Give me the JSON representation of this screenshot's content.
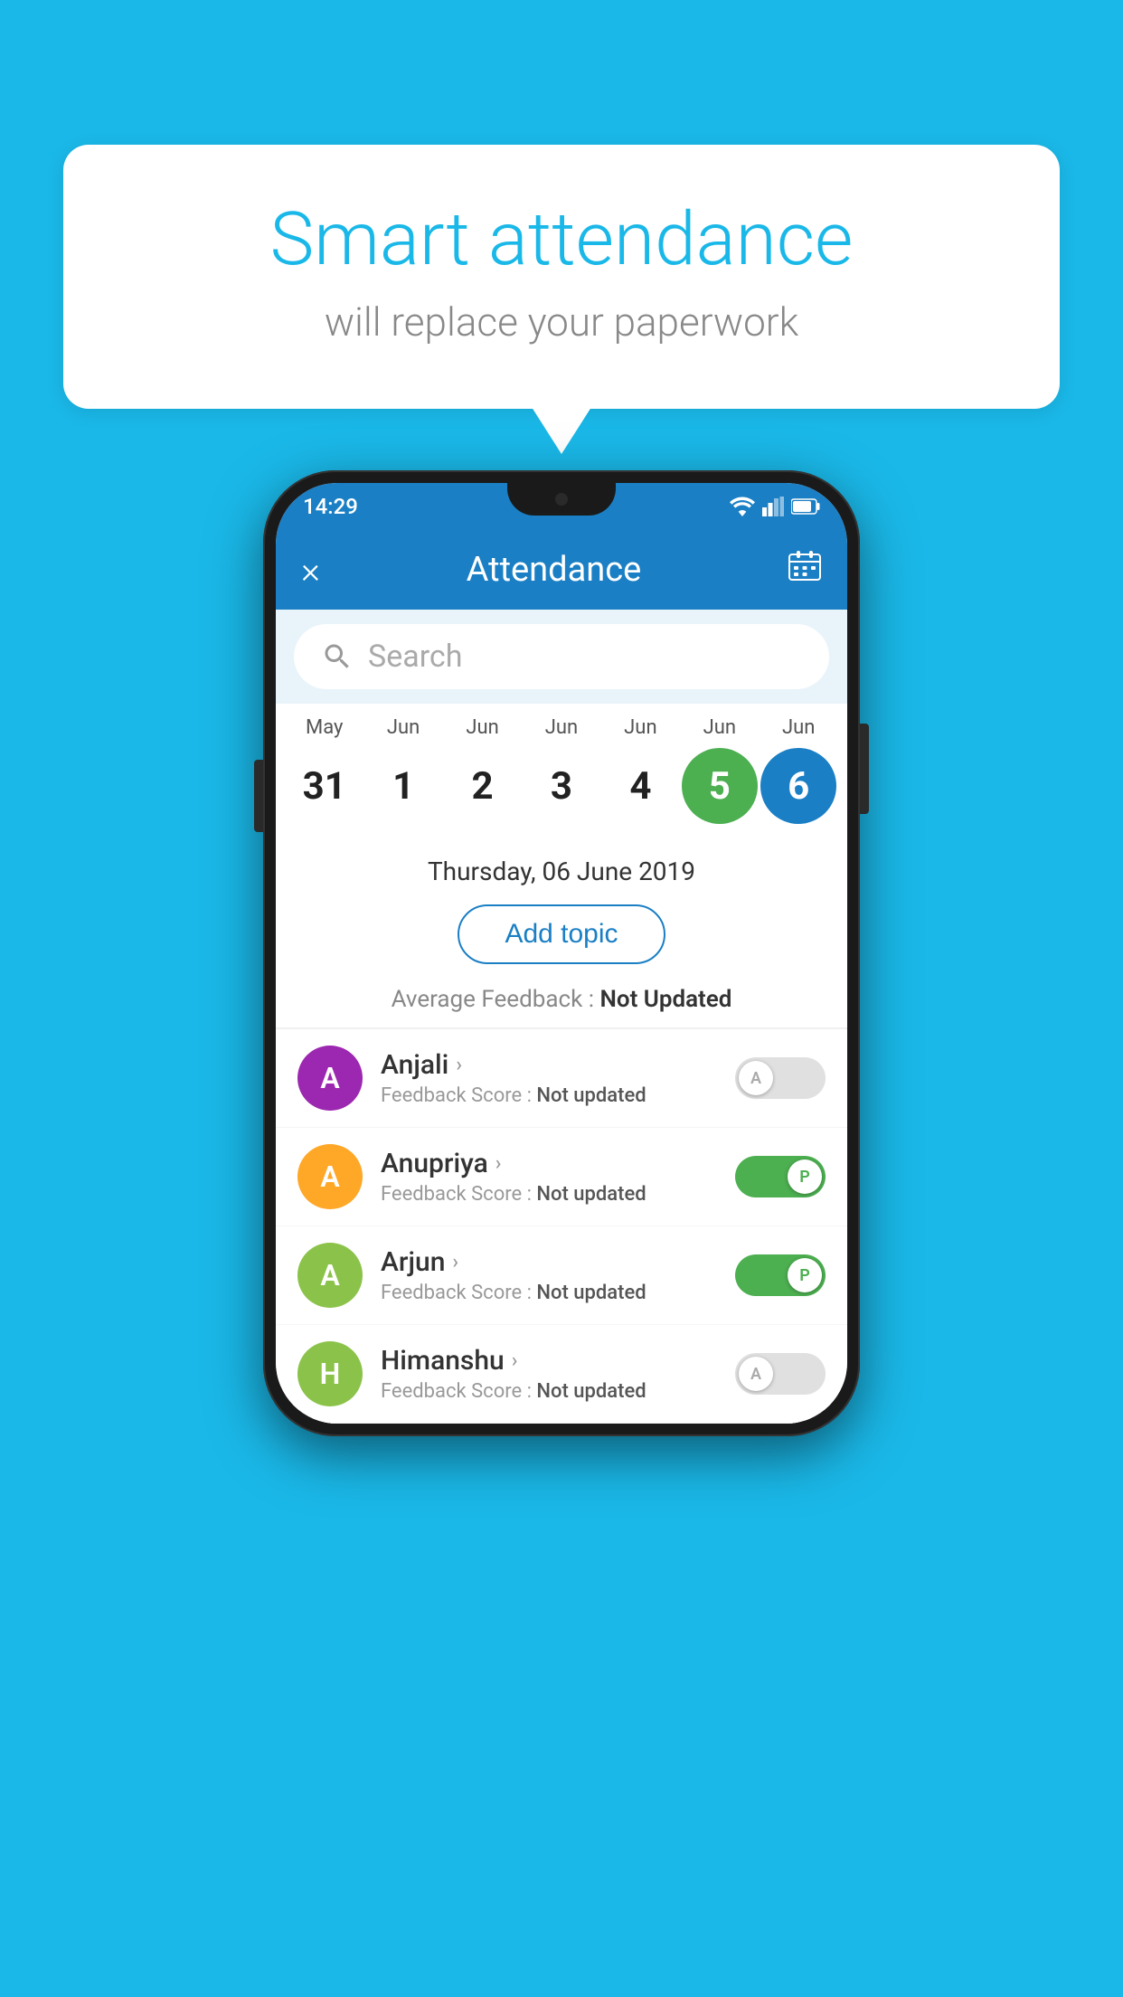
{
  "background": {
    "color": "#1ab8e8"
  },
  "speech_bubble": {
    "title": "Smart attendance",
    "subtitle": "will replace your paperwork"
  },
  "status_bar": {
    "time": "14:29"
  },
  "app_header": {
    "title": "Attendance",
    "close_label": "×",
    "calendar_label": "📅"
  },
  "search": {
    "placeholder": "Search"
  },
  "calendar": {
    "months": [
      "May",
      "Jun",
      "Jun",
      "Jun",
      "Jun",
      "Jun",
      "Jun"
    ],
    "dates": [
      "31",
      "1",
      "2",
      "3",
      "4",
      "5",
      "6"
    ],
    "states": [
      "normal",
      "normal",
      "normal",
      "normal",
      "normal",
      "today",
      "selected"
    ]
  },
  "date_label": "Thursday, 06 June 2019",
  "add_topic_btn": "Add topic",
  "feedback": {
    "label": "Average Feedback : ",
    "value": "Not Updated"
  },
  "students": [
    {
      "name": "Anjali",
      "avatar_letter": "A",
      "avatar_color": "#9c27b0",
      "score_label": "Feedback Score : ",
      "score_value": "Not updated",
      "toggle_state": "off",
      "toggle_label": "A"
    },
    {
      "name": "Anupriya",
      "avatar_letter": "A",
      "avatar_color": "#ffa726",
      "score_label": "Feedback Score : ",
      "score_value": "Not updated",
      "toggle_state": "on",
      "toggle_label": "P"
    },
    {
      "name": "Arjun",
      "avatar_letter": "A",
      "avatar_color": "#8bc34a",
      "score_label": "Feedback Score : ",
      "score_value": "Not updated",
      "toggle_state": "on",
      "toggle_label": "P"
    },
    {
      "name": "Himanshu",
      "avatar_letter": "H",
      "avatar_color": "#8bc34a",
      "score_label": "Feedback Score : ",
      "score_value": "Not updated",
      "toggle_state": "off",
      "toggle_label": "A"
    }
  ]
}
